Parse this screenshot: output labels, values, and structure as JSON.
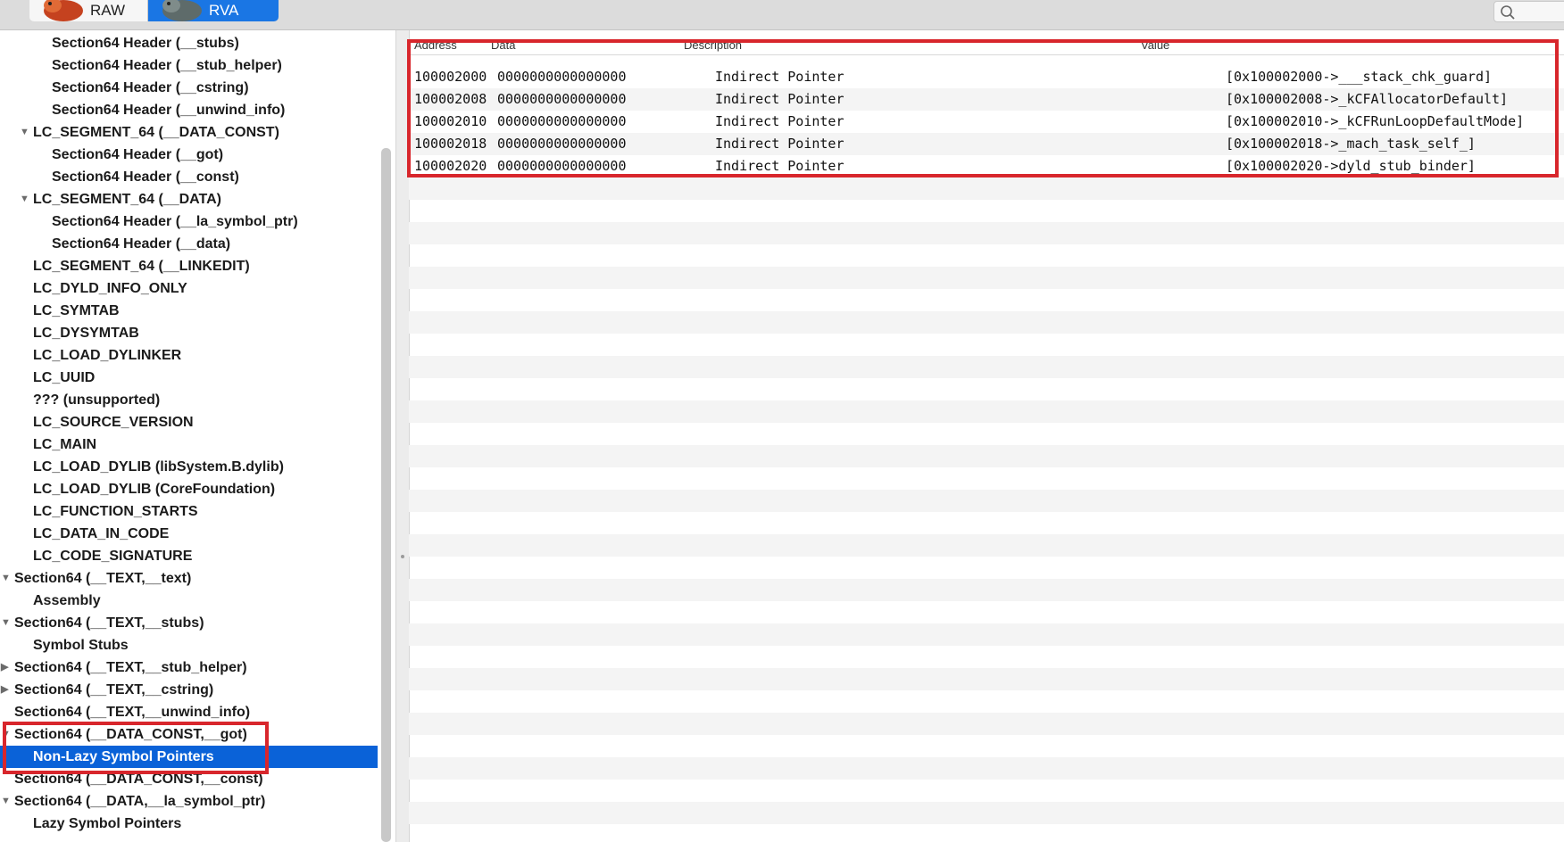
{
  "toolbar": {
    "raw_label": "RAW",
    "rva_label": "RVA"
  },
  "sidebar": {
    "items": [
      {
        "label": "Section64 Header (__stubs)",
        "indent": 2
      },
      {
        "label": "Section64 Header (__stub_helper)",
        "indent": 2
      },
      {
        "label": "Section64 Header (__cstring)",
        "indent": 2
      },
      {
        "label": "Section64 Header (__unwind_info)",
        "indent": 2
      },
      {
        "label": "LC_SEGMENT_64 (__DATA_CONST)",
        "indent": 1,
        "expanded": true
      },
      {
        "label": "Section64 Header (__got)",
        "indent": 2
      },
      {
        "label": "Section64 Header (__const)",
        "indent": 2
      },
      {
        "label": "LC_SEGMENT_64 (__DATA)",
        "indent": 1,
        "expanded": true
      },
      {
        "label": "Section64 Header (__la_symbol_ptr)",
        "indent": 2
      },
      {
        "label": "Section64 Header (__data)",
        "indent": 2
      },
      {
        "label": "LC_SEGMENT_64 (__LINKEDIT)",
        "indent": 1
      },
      {
        "label": "LC_DYLD_INFO_ONLY",
        "indent": 1
      },
      {
        "label": "LC_SYMTAB",
        "indent": 1
      },
      {
        "label": "LC_DYSYMTAB",
        "indent": 1
      },
      {
        "label": "LC_LOAD_DYLINKER",
        "indent": 1
      },
      {
        "label": "LC_UUID",
        "indent": 1
      },
      {
        "label": "??? (unsupported)",
        "indent": 1
      },
      {
        "label": "LC_SOURCE_VERSION",
        "indent": 1
      },
      {
        "label": "LC_MAIN",
        "indent": 1
      },
      {
        "label": "LC_LOAD_DYLIB (libSystem.B.dylib)",
        "indent": 1
      },
      {
        "label": "LC_LOAD_DYLIB (CoreFoundation)",
        "indent": 1
      },
      {
        "label": "LC_FUNCTION_STARTS",
        "indent": 1
      },
      {
        "label": "LC_DATA_IN_CODE",
        "indent": 1
      },
      {
        "label": "LC_CODE_SIGNATURE",
        "indent": 1
      },
      {
        "label": "Section64 (__TEXT,__text)",
        "indent": 0,
        "expanded": true
      },
      {
        "label": "Assembly",
        "indent": 1
      },
      {
        "label": "Section64 (__TEXT,__stubs)",
        "indent": 0,
        "expanded": true
      },
      {
        "label": "Symbol Stubs",
        "indent": 1
      },
      {
        "label": "Section64 (__TEXT,__stub_helper)",
        "indent": 0,
        "expanded": false
      },
      {
        "label": "Section64 (__TEXT,__cstring)",
        "indent": 0,
        "expanded": false
      },
      {
        "label": "Section64 (__TEXT,__unwind_info)",
        "indent": 0
      },
      {
        "label": "Section64 (__DATA_CONST,__got)",
        "indent": 0,
        "expanded": true
      },
      {
        "label": "Non-Lazy Symbol Pointers",
        "indent": 1,
        "selected": true
      },
      {
        "label": "Section64 (__DATA_CONST,__const)",
        "indent": 0
      },
      {
        "label": "Section64 (__DATA,__la_symbol_ptr)",
        "indent": 0,
        "expanded": true
      },
      {
        "label": "Lazy Symbol Pointers",
        "indent": 1
      }
    ]
  },
  "table": {
    "headers": [
      "Address",
      "Data",
      "Description",
      "Value"
    ],
    "rows": [
      [
        "100002000",
        "0000000000000000",
        "Indirect Pointer",
        "[0x100002000->___stack_chk_guard]"
      ],
      [
        "100002008",
        "0000000000000000",
        "Indirect Pointer",
        "[0x100002008->_kCFAllocatorDefault]"
      ],
      [
        "100002010",
        "0000000000000000",
        "Indirect Pointer",
        "[0x100002010->_kCFRunLoopDefaultMode]"
      ],
      [
        "100002018",
        "0000000000000000",
        "Indirect Pointer",
        "[0x100002018->_mach_task_self_]"
      ],
      [
        "100002020",
        "0000000000000000",
        "Indirect Pointer",
        "[0x100002020->dyld_stub_binder]"
      ]
    ]
  },
  "colors": {
    "selection": "#0a62d8",
    "highlight": "#d8262c",
    "rva_active": "#1a76e4"
  }
}
